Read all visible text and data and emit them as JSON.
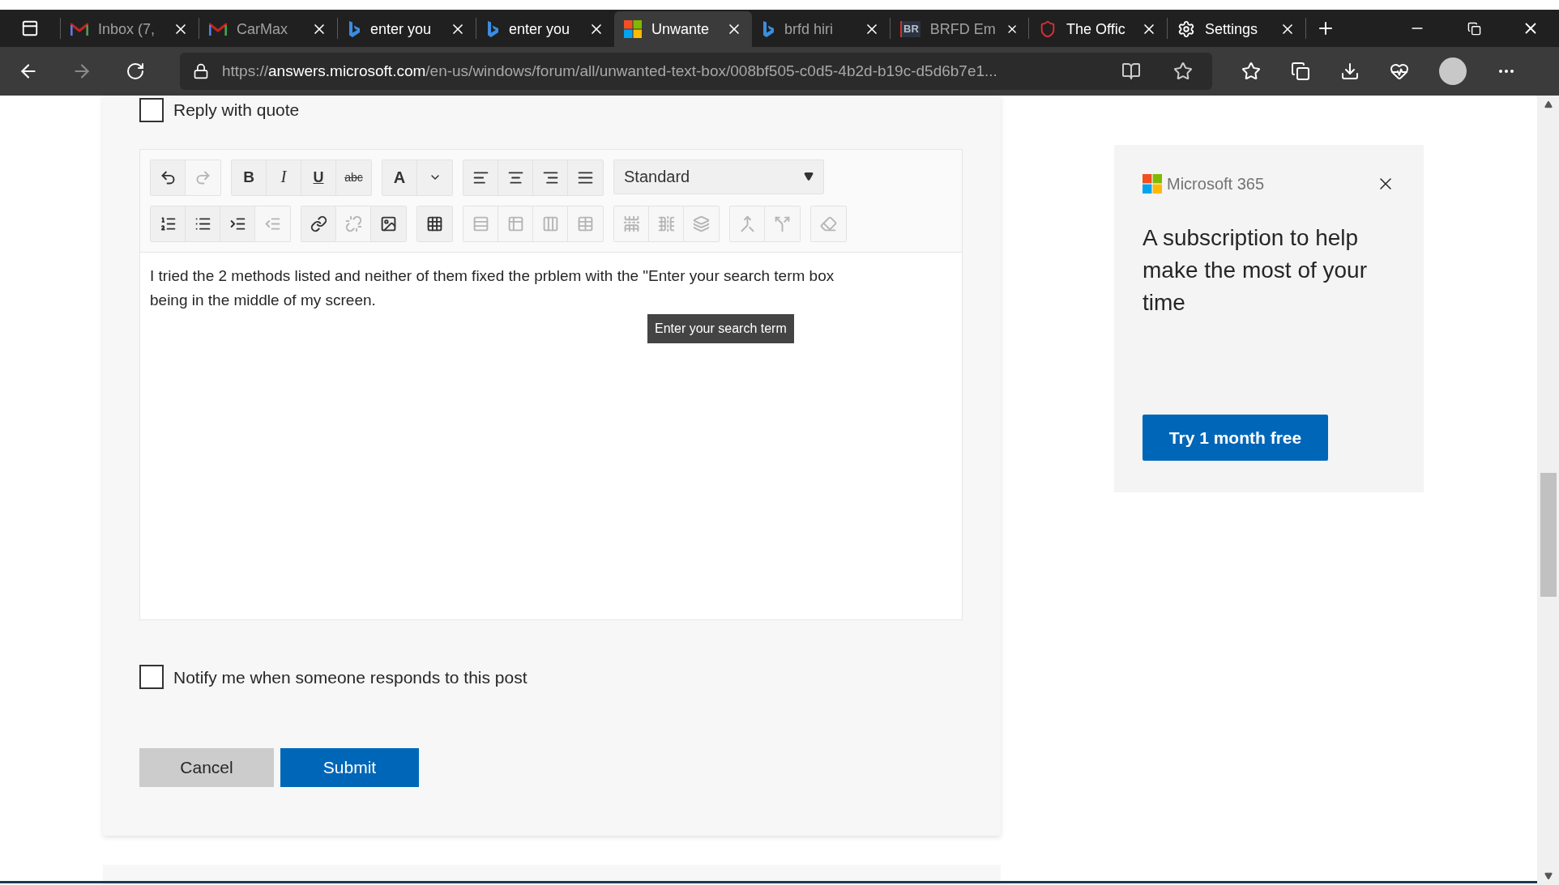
{
  "browser": {
    "tabs": [
      {
        "label": "Inbox (7,",
        "kind": "mail",
        "selected": false,
        "dimmed": true
      },
      {
        "label": "CarMax",
        "kind": "mail",
        "selected": false,
        "dimmed": true
      },
      {
        "label": "enter you",
        "kind": "search",
        "selected": false,
        "dimmed": false
      },
      {
        "label": "enter you",
        "kind": "search",
        "selected": false,
        "dimmed": false
      },
      {
        "label": "Unwante",
        "kind": "windows",
        "selected": true,
        "dimmed": false
      },
      {
        "label": "brfd hiri",
        "kind": "search",
        "selected": false,
        "dimmed": true
      },
      {
        "label": "BRFD Em",
        "kind": "badge",
        "badge": "BR",
        "selected": false,
        "dimmed": true
      },
      {
        "label": "The Offic",
        "kind": "shield",
        "selected": false,
        "dimmed": false
      },
      {
        "label": "Settings",
        "kind": "settings",
        "selected": false,
        "dimmed": false
      }
    ],
    "address": {
      "scheme": "https://",
      "host": "answers.microsoft.com",
      "path": "/en-us/windows/forum/all/unwanted-text-box/008bf505-c0d5-4b2d-b19c-d5d6b7e1..."
    }
  },
  "reply_with_quote": {
    "label": "Reply with quote",
    "checked": false
  },
  "editor": {
    "toolbar": [
      [
        {
          "buttons": [
            {
              "kind": "undo",
              "disabled": false
            },
            {
              "kind": "redo",
              "disabled": true
            }
          ]
        },
        {
          "buttons": [
            {
              "kind": "bold",
              "label": "B",
              "disabled": false
            },
            {
              "kind": "italic",
              "label": "I",
              "disabled": false
            },
            {
              "kind": "underline",
              "label": "U",
              "disabled": false
            },
            {
              "kind": "strike",
              "label": "abc",
              "disabled": false
            }
          ]
        },
        {
          "buttons": [
            {
              "kind": "font-color",
              "label": "A",
              "disabled": false
            },
            {
              "kind": "caret",
              "disabled": false
            }
          ]
        },
        {
          "buttons": [
            {
              "kind": "align-left",
              "disabled": false
            },
            {
              "kind": "align-center",
              "disabled": false
            },
            {
              "kind": "align-right",
              "disabled": false
            },
            {
              "kind": "justify",
              "disabled": false
            }
          ]
        },
        {
          "select": "Standard"
        }
      ],
      [
        {
          "buttons": [
            {
              "kind": "ordered-list",
              "disabled": false
            },
            {
              "kind": "bullet-list",
              "disabled": false
            },
            {
              "kind": "indent",
              "disabled": false
            },
            {
              "kind": "outdent",
              "disabled": true
            }
          ]
        },
        {
          "buttons": [
            {
              "kind": "link",
              "disabled": false
            },
            {
              "kind": "unlink",
              "disabled": true
            },
            {
              "kind": "image",
              "disabled": false
            }
          ]
        },
        {
          "buttons": [
            {
              "kind": "table",
              "disabled": false
            }
          ]
        },
        {
          "buttons": [
            {
              "kind": "row-above",
              "disabled": true
            },
            {
              "kind": "row-below",
              "disabled": true
            },
            {
              "kind": "col-left",
              "disabled": true
            },
            {
              "kind": "col-right",
              "disabled": true
            }
          ]
        },
        {
          "buttons": [
            {
              "kind": "delete-row",
              "disabled": true
            },
            {
              "kind": "delete-col",
              "disabled": true
            },
            {
              "kind": "delete-table",
              "disabled": true
            }
          ]
        },
        {
          "buttons": [
            {
              "kind": "merge",
              "disabled": true
            },
            {
              "kind": "split",
              "disabled": true
            }
          ]
        },
        {
          "buttons": [
            {
              "kind": "clear",
              "disabled": true
            }
          ]
        }
      ]
    ],
    "body": "I tried the 2 methods listed and neither of them fixed the prblem with the \"Enter your search term box being in the middle of my screen.",
    "tooltip": "Enter your search term"
  },
  "notify": {
    "label": "Notify me when someone responds to this post",
    "checked": false
  },
  "buttons": {
    "cancel": "Cancel",
    "submit": "Submit"
  },
  "ad": {
    "brand": "Microsoft 365",
    "headline": "A subscription to help make the most of your time",
    "cta": "Try 1 month free"
  }
}
